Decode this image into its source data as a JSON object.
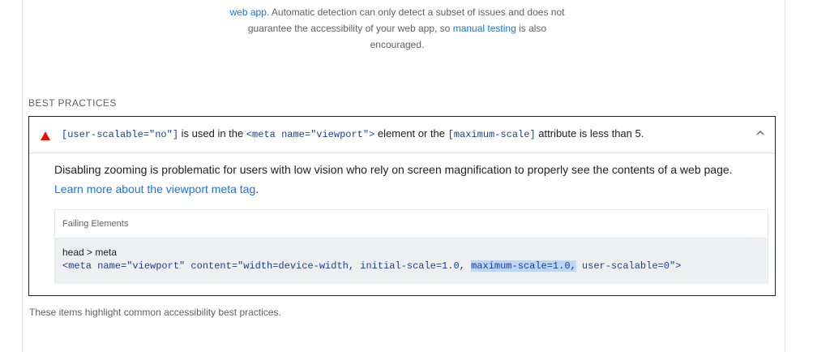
{
  "intro": {
    "link1": "web app",
    "text1": ". Automatic detection can only detect a subset of issues and does not guarantee the accessibility of your web app, so ",
    "link2": "manual testing",
    "text2": " is also encouraged."
  },
  "section": {
    "title": "BEST PRACTICES"
  },
  "audit": {
    "title_parts": {
      "code1": "[user-scalable=\"no\"]",
      "text1": " is used in the ",
      "code2": "<meta name=\"viewport\">",
      "text2": " element or the ",
      "code3": "[maximum-scale]",
      "text3": " attribute is less than 5."
    },
    "description": "Disabling zooming is problematic for users with low vision who rely on screen magnification to properly see the contents of a web page. ",
    "learn_more": "Learn more about the viewport meta tag",
    "description_end": ".",
    "status_color": "#eb0f00",
    "icons": {
      "status": "fail-triangle-icon",
      "toggle": "chevron-up-icon"
    }
  },
  "details": {
    "header": "Failing Elements",
    "node_path": "head > meta",
    "snippet_before": "<meta name=\"viewport\" content=\"width=device-width, initial-scale=1.0, ",
    "snippet_highlight": "maximum-scale=1.0,",
    "snippet_after": " user-scalable=0\">"
  },
  "footer": {
    "note": "These items highlight common accessibility best practices."
  }
}
